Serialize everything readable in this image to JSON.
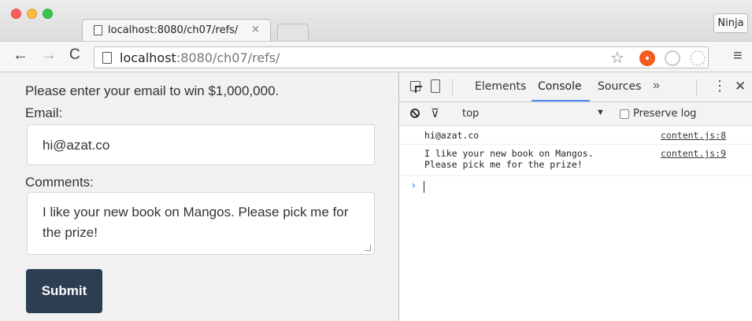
{
  "browser": {
    "tab_title": "localhost:8080/ch07/refs/",
    "tab_close": "×",
    "profile_label": "Ninja",
    "url_host": "localhost",
    "url_path": ":8080/ch07/refs/",
    "icons": {
      "back": "←",
      "forward": "→",
      "reload": "C",
      "star": "☆",
      "menu": "≡"
    }
  },
  "page": {
    "intro": "Please enter your email to win $1,000,000.",
    "email_label": "Email:",
    "email_value": "hi@azat.co",
    "comments_label": "Comments:",
    "comments_value": "I like your new book on Mangos. Please pick me for the prize!",
    "submit_label": "Submit",
    "colors": {
      "submit_bg": "#2c3e50",
      "page_bg": "#f1f1f1"
    }
  },
  "devtools": {
    "tabs": [
      "Elements",
      "Console",
      "Sources"
    ],
    "active_tab": "Console",
    "more": "»",
    "kebab": "⋮",
    "close": "✕",
    "filter_icon": "⊽",
    "context": "top",
    "context_arrow": "▼",
    "preserve_log": "Preserve log",
    "logs": [
      {
        "message": "hi@azat.co",
        "source": "content.js:8"
      },
      {
        "message": "I like your new book on Mangos.\nPlease pick me for the prize!",
        "source": "content.js:9"
      }
    ],
    "prompt": "›",
    "colors": {
      "active_tab_underline": "#4a8af4",
      "prompt": "#367cf1"
    }
  }
}
